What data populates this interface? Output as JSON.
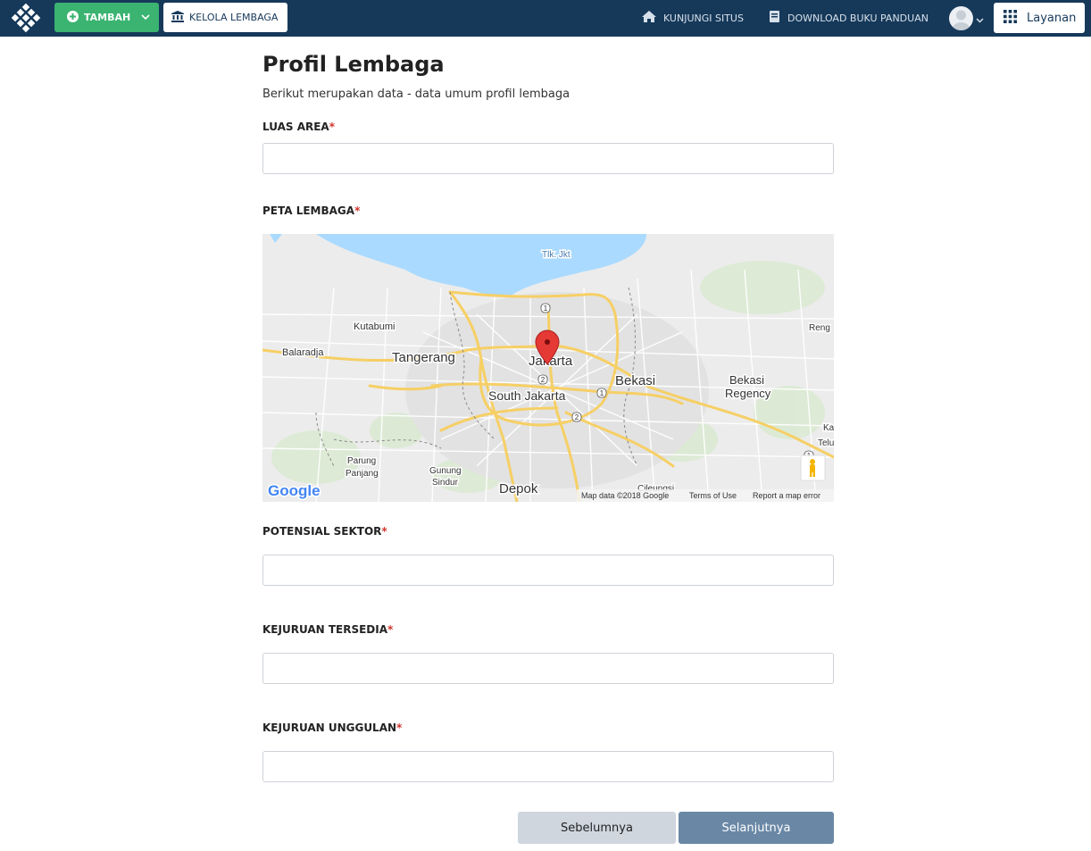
{
  "navbar": {
    "tambah_label": "TAMBAH",
    "kelola_label": "KELOLA LEMBAGA",
    "kunjungi_label": "KUNJUNGI SITUS",
    "download_label": "DOWNLOAD BUKU PANDUAN",
    "layanan_label": "Layanan",
    "colors": {
      "bar": "#16395a",
      "tambah": "#3bb371"
    },
    "icons": [
      "logo-icon",
      "plus-circle-icon",
      "chevron-down-icon",
      "institution-icon",
      "home-icon",
      "book-icon",
      "avatar-icon",
      "grid-icon"
    ]
  },
  "page": {
    "title": "Profil Lembaga",
    "subtitle": "Berikut merupakan data - data umum profil lembaga"
  },
  "form": {
    "luas_area": {
      "label": "LUAS AREA",
      "required": "*",
      "value": ""
    },
    "peta_lembaga": {
      "label": "PETA LEMBAGA",
      "required": "*"
    },
    "potensial_sektor": {
      "label": "POTENSIAL SEKTOR",
      "required": "*",
      "value": ""
    },
    "kejuruan_tersedia": {
      "label": "KEJURUAN TERSEDIA",
      "required": "*",
      "value": ""
    },
    "kejuruan_unggulan": {
      "label": "KEJURUAN UNGGULAN",
      "required": "*",
      "value": ""
    }
  },
  "map": {
    "places": {
      "tlk": "Tlk. Jkt",
      "kutabumi": "Kutabumi",
      "balaradja": "Balaradja",
      "tangerang": "Tangerang",
      "jakarta": "Jakarta",
      "south_jakarta": "South Jakarta",
      "bekasi": "Bekasi",
      "bekasi_regency_1": "Bekasi",
      "bekasi_regency_2": "Regency",
      "rengas": "Reng",
      "ka": "Ka",
      "telu": "Telu",
      "parung_1": "Parung",
      "parung_2": "Panjang",
      "gunung_1": "Gunung",
      "gunung_2": "Sindur",
      "depok": "Depok",
      "cileungsi": "Cileungsi"
    },
    "road_shields": [
      "1",
      "2",
      "1",
      "2",
      "1"
    ],
    "google_logo": "Google",
    "attribution": "Map data ©2018 Google",
    "terms": "Terms of Use",
    "report": "Report a map error"
  },
  "buttons": {
    "prev": "Sebelumnya",
    "next": "Selanjutnya"
  }
}
